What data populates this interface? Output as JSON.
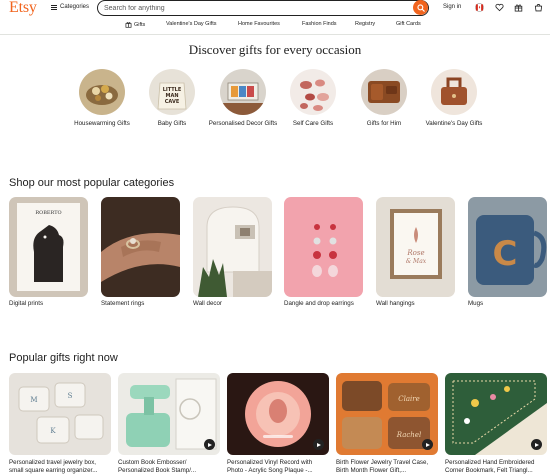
{
  "header": {
    "logo": "Etsy",
    "categories_label": "Categories",
    "search_placeholder": "Search for anything",
    "sign_in": "Sign in"
  },
  "nav": {
    "items": [
      "Gifts",
      "Valentine's Day Gifts",
      "Home Favourites",
      "Fashion Finds",
      "Registry",
      "Gift Cards"
    ]
  },
  "occasions": {
    "title": "Discover gifts for every occasion",
    "items": [
      {
        "label": "Housewarming Gifts"
      },
      {
        "label": "Baby Gifts"
      },
      {
        "label": "Personalised Decor Gifts"
      },
      {
        "label": "Self Care Gifts"
      },
      {
        "label": "Gifts for Him"
      },
      {
        "label": "Valentine's Day Gifts"
      }
    ]
  },
  "categories": {
    "title": "Shop our most popular categories",
    "items": [
      {
        "label": "Digital prints"
      },
      {
        "label": "Statement rings"
      },
      {
        "label": "Wall decor"
      },
      {
        "label": "Dangle and drop earrings"
      },
      {
        "label": "Wall hangings"
      },
      {
        "label": "Mugs"
      }
    ]
  },
  "popular": {
    "title": "Popular gifts right now",
    "items": [
      {
        "title": "Personalized travel jewelry box, small square earring organizer..."
      },
      {
        "title": "Custom Book Embosser/ Personalized Book Stamp/..."
      },
      {
        "title": "Personalized Vinyl Record with Photo - Acrylic Song Plaque -..."
      },
      {
        "title": "Birth Flower Jewelry Travel Case, Birth Month Flower Gift,..."
      },
      {
        "title": "Personalized Hand Embroidered Corner Bookmark, Felt Triangl..."
      }
    ]
  },
  "colors": {
    "brand": "#f1641e",
    "text": "#222222",
    "divider": "#e1e3df"
  }
}
